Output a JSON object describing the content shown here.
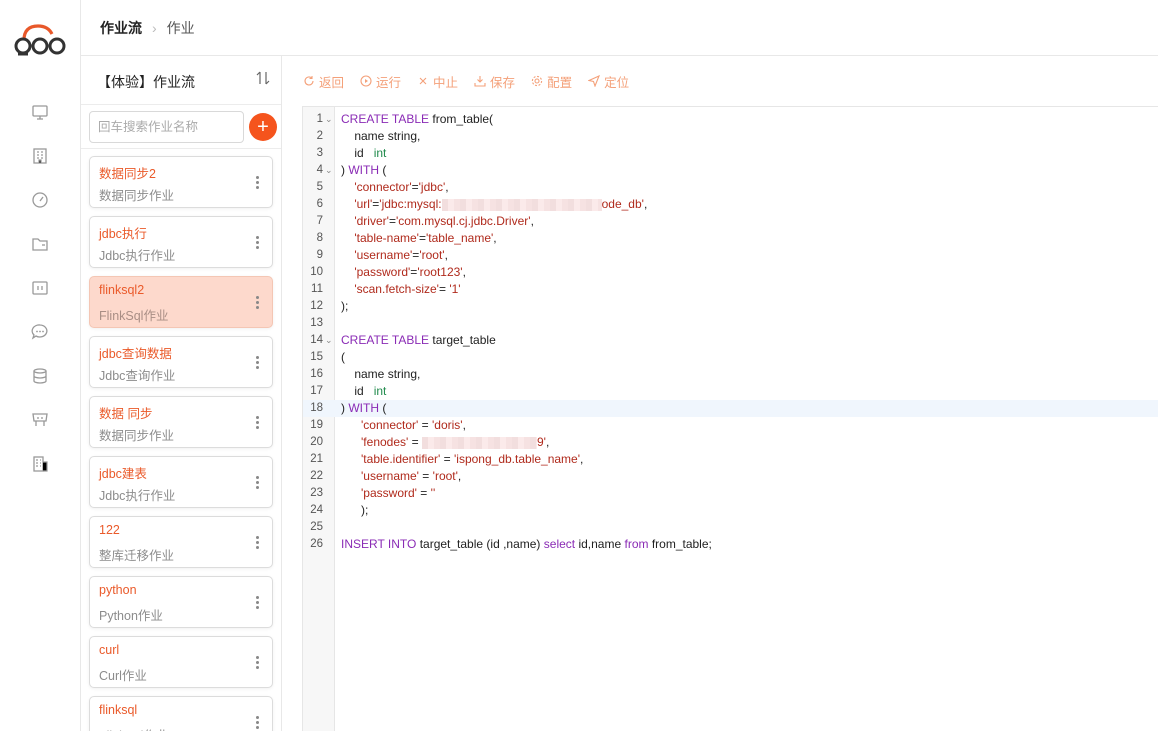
{
  "header": {
    "breadcrumb_root": "作业流",
    "breadcrumb_current": "作业"
  },
  "panel": {
    "title": "【体验】作业流",
    "search_placeholder": "回车搜索作业名称",
    "jobs": [
      {
        "name": "数据同步2",
        "type": "数据同步作业"
      },
      {
        "name": "jdbc执行",
        "type": "Jdbc执行作业"
      },
      {
        "name": "flinksql2",
        "type": "FlinkSql作业"
      },
      {
        "name": "jdbc查询数据",
        "type": "Jdbc查询作业"
      },
      {
        "name": "数据 同步",
        "type": "数据同步作业"
      },
      {
        "name": "jdbc建表",
        "type": "Jdbc执行作业"
      },
      {
        "name": "122",
        "type": "整库迁移作业"
      },
      {
        "name": "python",
        "type": "Python作业"
      },
      {
        "name": "curl",
        "type": "Curl作业"
      },
      {
        "name": "flinksql",
        "type": "FlinkSql作业"
      }
    ],
    "active_job": "flinksql2"
  },
  "toolbar": {
    "back": "返回",
    "run": "运行",
    "stop": "中止",
    "save": "保存",
    "config": "配置",
    "locate": "定位"
  },
  "colors": {
    "accent": "#f5541d",
    "active_card": "#fdd9cc",
    "keyword": "#8a2bb5",
    "string": "#b02a1c",
    "type": "#208a4c"
  },
  "editor": {
    "lines": [
      {
        "n": "1",
        "fold": true,
        "parts": [
          [
            "kw",
            "CREATE TABLE"
          ],
          [
            "",
            " from_table("
          ]
        ]
      },
      {
        "n": "2",
        "parts": [
          [
            "",
            "    name string,"
          ]
        ]
      },
      {
        "n": "3",
        "parts": [
          [
            "",
            "    id   "
          ],
          [
            "typ",
            "int"
          ]
        ]
      },
      {
        "n": "4",
        "fold": true,
        "parts": [
          [
            "",
            ") "
          ],
          [
            "kw",
            "WITH"
          ],
          [
            "",
            " ("
          ]
        ]
      },
      {
        "n": "5",
        "parts": [
          [
            "",
            "    "
          ],
          [
            "str",
            "'connector'"
          ],
          [
            "",
            "="
          ],
          [
            "str",
            "'jdbc'"
          ],
          [
            "",
            ","
          ]
        ]
      },
      {
        "n": "6",
        "parts": [
          [
            "",
            "    "
          ],
          [
            "str",
            "'url'"
          ],
          [
            "",
            "="
          ],
          [
            "str",
            "'jdbc:mysql:"
          ],
          [
            "redact",
            "160"
          ],
          [
            "str",
            "ode_db'"
          ],
          [
            "",
            ","
          ]
        ]
      },
      {
        "n": "7",
        "parts": [
          [
            "",
            "    "
          ],
          [
            "str",
            "'driver'"
          ],
          [
            "",
            "="
          ],
          [
            "str",
            "'com.mysql.cj.jdbc.Driver'"
          ],
          [
            "",
            ","
          ]
        ]
      },
      {
        "n": "8",
        "parts": [
          [
            "",
            "    "
          ],
          [
            "str",
            "'table-name'"
          ],
          [
            "",
            "="
          ],
          [
            "str",
            "'table_name'"
          ],
          [
            "",
            ","
          ]
        ]
      },
      {
        "n": "9",
        "parts": [
          [
            "",
            "    "
          ],
          [
            "str",
            "'username'"
          ],
          [
            "",
            "="
          ],
          [
            "str",
            "'root'"
          ],
          [
            "",
            ","
          ]
        ]
      },
      {
        "n": "10",
        "parts": [
          [
            "",
            "    "
          ],
          [
            "str",
            "'password'"
          ],
          [
            "",
            "="
          ],
          [
            "str",
            "'root123'"
          ],
          [
            "",
            ","
          ]
        ]
      },
      {
        "n": "11",
        "parts": [
          [
            "",
            "    "
          ],
          [
            "str",
            "'scan.fetch-size'"
          ],
          [
            "",
            "= "
          ],
          [
            "str",
            "'1'"
          ]
        ]
      },
      {
        "n": "12",
        "parts": [
          [
            "",
            ");"
          ]
        ]
      },
      {
        "n": "13",
        "parts": [
          [
            "",
            ""
          ]
        ]
      },
      {
        "n": "14",
        "fold": true,
        "parts": [
          [
            "kw",
            "CREATE TABLE"
          ],
          [
            "",
            " target_table"
          ]
        ]
      },
      {
        "n": "15",
        "parts": [
          [
            "",
            "("
          ]
        ]
      },
      {
        "n": "16",
        "parts": [
          [
            "",
            "    name string,"
          ]
        ]
      },
      {
        "n": "17",
        "parts": [
          [
            "",
            "    id   "
          ],
          [
            "typ",
            "int"
          ]
        ]
      },
      {
        "n": "18",
        "hl": true,
        "parts": [
          [
            "",
            ") "
          ],
          [
            "kw",
            "WITH"
          ],
          [
            "",
            " ("
          ]
        ]
      },
      {
        "n": "19",
        "parts": [
          [
            "",
            "      "
          ],
          [
            "str",
            "'connector'"
          ],
          [
            "",
            " = "
          ],
          [
            "str",
            "'doris'"
          ],
          [
            "",
            ","
          ]
        ]
      },
      {
        "n": "20",
        "parts": [
          [
            "",
            "      "
          ],
          [
            "str",
            "'fenodes'"
          ],
          [
            "",
            " = "
          ],
          [
            "redact",
            "115"
          ],
          [
            "str",
            "9'"
          ],
          [
            "",
            ","
          ]
        ]
      },
      {
        "n": "21",
        "parts": [
          [
            "",
            "      "
          ],
          [
            "str",
            "'table.identifier'"
          ],
          [
            "",
            " = "
          ],
          [
            "str",
            "'ispong_db.table_name'"
          ],
          [
            "",
            ","
          ]
        ]
      },
      {
        "n": "22",
        "parts": [
          [
            "",
            "      "
          ],
          [
            "str",
            "'username'"
          ],
          [
            "",
            " = "
          ],
          [
            "str",
            "'root'"
          ],
          [
            "",
            ","
          ]
        ]
      },
      {
        "n": "23",
        "parts": [
          [
            "",
            "      "
          ],
          [
            "str",
            "'password'"
          ],
          [
            "",
            " = "
          ],
          [
            "str",
            "''"
          ]
        ]
      },
      {
        "n": "24",
        "parts": [
          [
            "",
            "      );"
          ]
        ]
      },
      {
        "n": "25",
        "parts": [
          [
            "",
            ""
          ]
        ]
      },
      {
        "n": "26",
        "parts": [
          [
            "kw",
            "INSERT INTO"
          ],
          [
            "",
            " target_table (id ,name) "
          ],
          [
            "kw",
            "select"
          ],
          [
            "",
            " id,name "
          ],
          [
            "kw",
            "from"
          ],
          [
            "",
            " from_table;"
          ]
        ]
      }
    ]
  }
}
